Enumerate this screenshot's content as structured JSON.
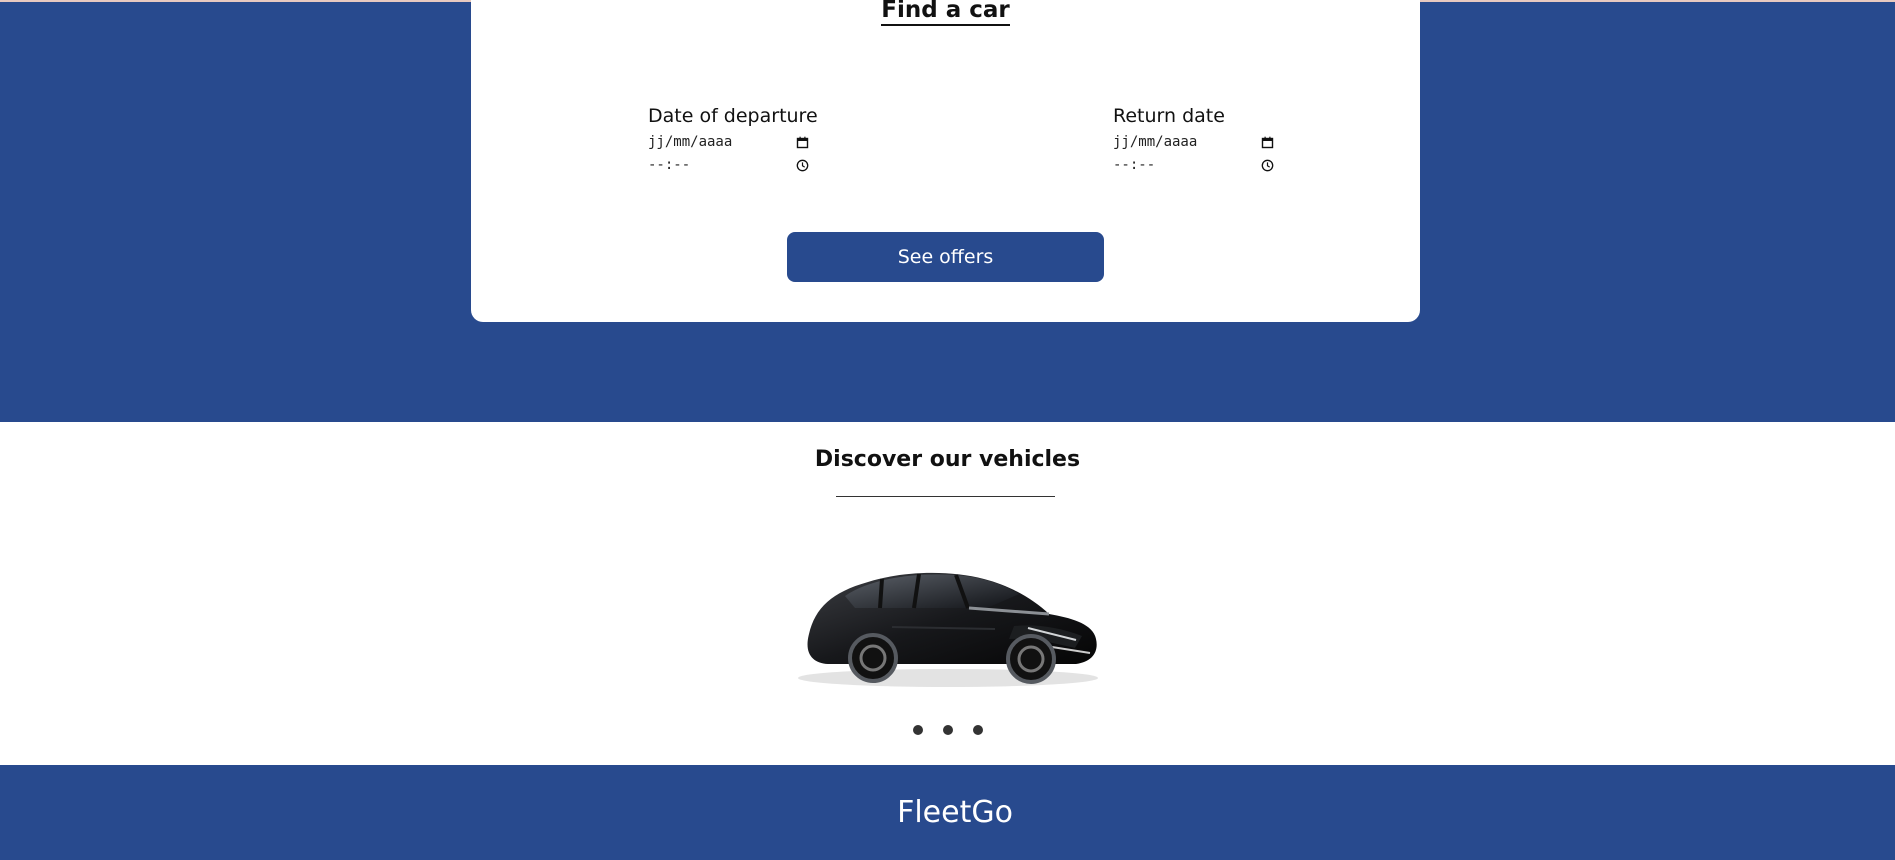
{
  "search_form": {
    "title": "Find a car",
    "departure": {
      "label": "Date of departure",
      "date_value": "jj/mm/aaaa",
      "time_value": "--:--"
    },
    "return": {
      "label": "Return date",
      "date_value": "jj/mm/aaaa",
      "time_value": "--:--"
    },
    "submit_label": "See offers"
  },
  "vehicles": {
    "title": "Discover our vehicles",
    "image_alt": "Black hatchback car",
    "carousel_dots": 3
  },
  "footer": {
    "brand": "FleetGo"
  },
  "theme": {
    "primary": "#284a8e",
    "surface": "#ffffff",
    "text": "#111111"
  },
  "icons": {
    "date_picker": "calendar-icon",
    "time_picker": "clock-icon"
  }
}
